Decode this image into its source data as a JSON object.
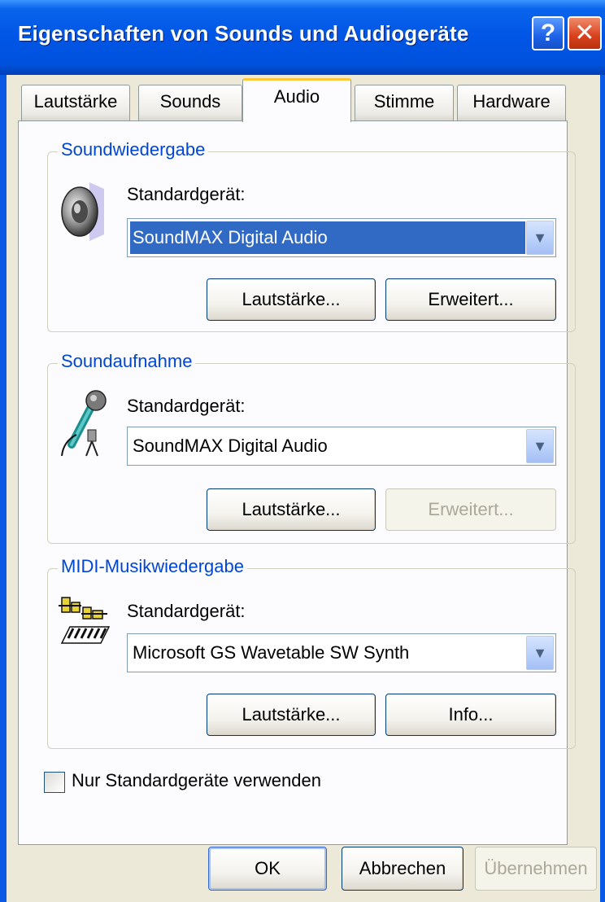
{
  "window": {
    "title": "Eigenschaften von Sounds und Audiogeräte",
    "help_glyph": "?",
    "close_glyph": "✕"
  },
  "tabs": [
    {
      "label": "Lautstärke",
      "active": false
    },
    {
      "label": "Sounds",
      "active": false
    },
    {
      "label": "Audio",
      "active": true
    },
    {
      "label": "Stimme",
      "active": false
    },
    {
      "label": "Hardware",
      "active": false
    }
  ],
  "groups": {
    "playback": {
      "label": "Soundwiedergabe",
      "icon": "speaker-icon",
      "device_label": "Standardgerät:",
      "device_value": "SoundMAX Digital Audio",
      "volume_button": "Lautstärke...",
      "second_button": "Erweitert...",
      "second_enabled": true
    },
    "recording": {
      "label": "Soundaufnahme",
      "icon": "microphone-icon",
      "device_label": "Standardgerät:",
      "device_value": "SoundMAX Digital Audio",
      "volume_button": "Lautstärke...",
      "second_button": "Erweitert...",
      "second_enabled": false
    },
    "midi": {
      "label": "MIDI-Musikwiedergabe",
      "icon": "midi-keyboard-icon",
      "device_label": "Standardgerät:",
      "device_value": "Microsoft GS Wavetable SW Synth",
      "volume_button": "Lautstärke...",
      "second_button": "Info...",
      "second_enabled": true
    }
  },
  "only_default_devices": {
    "label": "Nur Standardgeräte verwenden",
    "checked": false
  },
  "footer": {
    "ok": "OK",
    "cancel": "Abbrechen",
    "apply": "Übernehmen"
  },
  "colors": {
    "title_bar": "#0055E5",
    "group_label": "#0046D5",
    "selection": "#316AC5",
    "dialog_bg": "#ECE9D8"
  }
}
